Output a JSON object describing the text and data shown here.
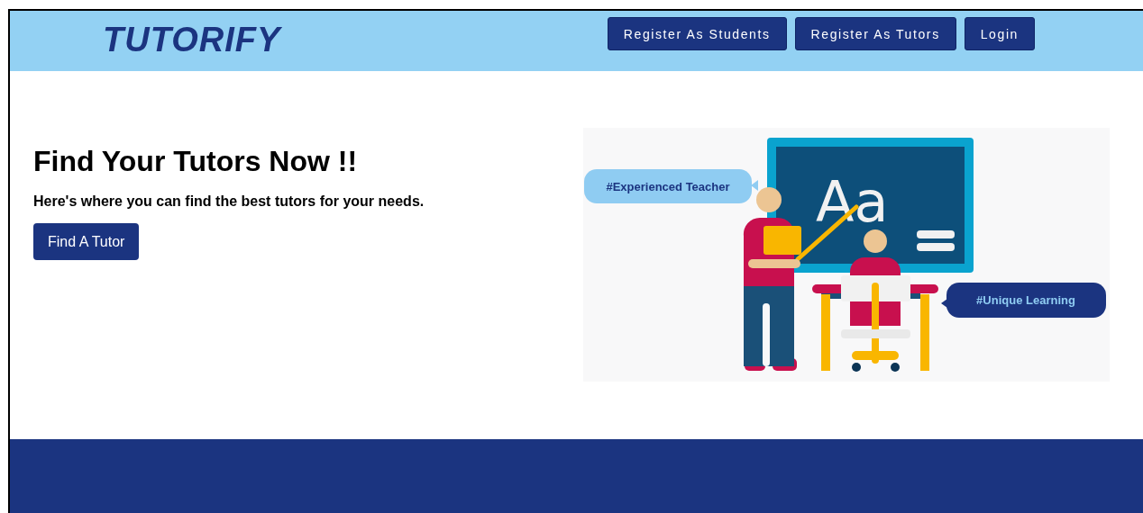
{
  "header": {
    "logo": "TUTORIFY",
    "nav": [
      {
        "label": "Register As Students"
      },
      {
        "label": "Register As Tutors"
      },
      {
        "label": "Login"
      }
    ]
  },
  "hero": {
    "title": "Find Your Tutors Now !!",
    "subtitle": "Here's where you can find the best tutors for your needs.",
    "button": "Find A Tutor",
    "illustration": {
      "board_text": "Aa",
      "bubbles": [
        {
          "text": "#Experienced Teacher"
        },
        {
          "text": "#Unique Learning"
        }
      ]
    }
  }
}
